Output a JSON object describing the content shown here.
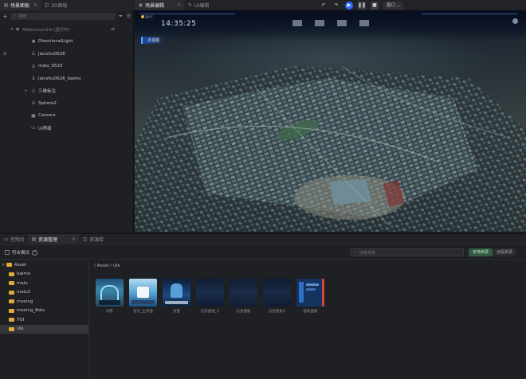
{
  "left_panel": {
    "tabs": [
      {
        "label": "场景面板",
        "active": true
      },
      {
        "label": "2D面板",
        "active": false
      }
    ],
    "search_placeholder": "搜索",
    "tree": [
      {
        "label": "Millennium19 (运行中)",
        "depth": 0,
        "icon": "scene-icon",
        "root": true
      },
      {
        "label": "DirectionalLight",
        "depth": 1,
        "icon": "sun-icon"
      },
      {
        "label": "jianzhu0626",
        "depth": 1,
        "icon": "mesh-icon",
        "hidden": true
      },
      {
        "label": "malu_0520",
        "depth": 1,
        "icon": "mesh-icon"
      },
      {
        "label": "jianzhu0626_baimo",
        "depth": 1,
        "icon": "mesh-icon"
      },
      {
        "label": "三维标注",
        "depth": 1,
        "icon": "group-icon",
        "expandable": true
      },
      {
        "label": "Sphere2",
        "depth": 1,
        "icon": "mesh-icon"
      },
      {
        "label": "Camera",
        "depth": 1,
        "icon": "camera-icon"
      },
      {
        "label": "UI界面",
        "depth": 1,
        "icon": "ui-icon"
      }
    ]
  },
  "viewport": {
    "tabs": [
      {
        "label": "场景编辑",
        "active": true
      },
      {
        "label": "UI编辑",
        "active": false
      }
    ],
    "layout_label": "窗口",
    "hud": {
      "time": "14:35:25",
      "weather_temp": "20°C",
      "tag": "近视图"
    }
  },
  "bottom_panel": {
    "tabs": [
      {
        "label": "控制台",
        "active": false
      },
      {
        "label": "资源管理",
        "active": true
      },
      {
        "label": "资源库",
        "active": false
      }
    ],
    "edit_mode_label": "符合模式",
    "search_placeholder": "搜索资源",
    "segments": [
      "本地资源",
      "远程资源"
    ],
    "breadcrumb": "/ Asset / UIs",
    "folders": [
      {
        "label": "Asset",
        "depth": 0,
        "expanded": true
      },
      {
        "label": "baimo",
        "depth": 1
      },
      {
        "label": "malu",
        "depth": 1
      },
      {
        "label": "malu2",
        "depth": 1
      },
      {
        "label": "moxing",
        "depth": 1
      },
      {
        "label": "moxing_8otu",
        "depth": 1
      },
      {
        "label": "TOI",
        "depth": 1
      },
      {
        "label": "UIs",
        "depth": 1,
        "selected": true
      }
    ],
    "assets": [
      {
        "label": "场景",
        "kind": "scene-thumbnail"
      },
      {
        "label": "首页_主界面",
        "kind": "ui-thumbnail"
      },
      {
        "label": "封面",
        "kind": "ui-thumbnail"
      },
      {
        "label": "信息面板_1",
        "kind": "dark-thumbnail"
      },
      {
        "label": "信息面板",
        "kind": "dark-thumbnail"
      },
      {
        "label": "信息面板2",
        "kind": "dark-thumbnail"
      },
      {
        "label": "图表面板",
        "kind": "panel-thumbnail"
      }
    ]
  }
}
